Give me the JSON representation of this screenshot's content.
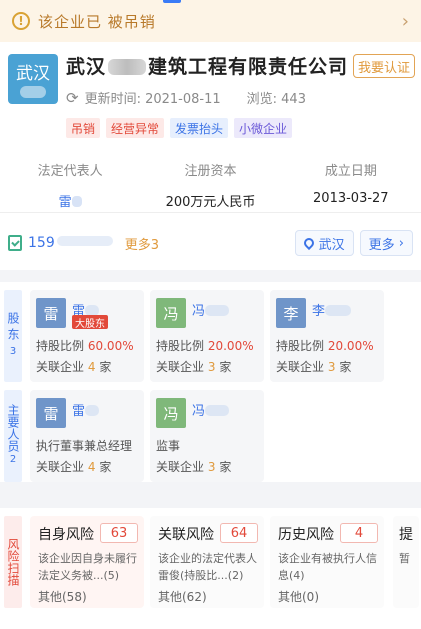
{
  "notice": {
    "text": "该企业已 被吊销",
    "arrow": "›"
  },
  "company": {
    "logo_text": "武汉",
    "name_prefix": "武汉",
    "name_suffix": "建筑工程有限责任公司",
    "claim_label": "我要认证",
    "updated_label": "更新时间: 2021-08-11",
    "views_label": "浏览: 443",
    "tags": [
      "吊销",
      "经营异常",
      "发票抬头",
      "小微企业"
    ]
  },
  "facts": [
    {
      "label": "法定代表人",
      "value": "雷"
    },
    {
      "label": "注册资本",
      "value": "200万元人民币"
    },
    {
      "label": "成立日期",
      "value": "2013-03-27"
    }
  ],
  "contact": {
    "phone_prefix": "159",
    "more_phones": "更多3",
    "location": "武汉",
    "more": "更多"
  },
  "shareholders": {
    "side_label": "股东",
    "count": "3",
    "cards": [
      {
        "avatar": "雷",
        "name": "雷",
        "tag": "大股东",
        "ratio_label": "持股比例",
        "ratio": "60.00%",
        "rel_label": "关联企业",
        "rel_count": "4",
        "rel_unit": "家"
      },
      {
        "avatar": "冯",
        "name": "冯",
        "tag": "",
        "ratio_label": "持股比例",
        "ratio": "20.00%",
        "rel_label": "关联企业",
        "rel_count": "3",
        "rel_unit": "家"
      },
      {
        "avatar": "李",
        "name": "李",
        "tag": "",
        "ratio_label": "持股比例",
        "ratio": "20.00%",
        "rel_label": "关联企业",
        "rel_count": "3",
        "rel_unit": "家"
      }
    ]
  },
  "staff": {
    "side_label": "主要人员",
    "count": "2",
    "cards": [
      {
        "avatar": "雷",
        "name": "雷",
        "role": "执行董事兼总经理",
        "rel_label": "关联企业",
        "rel_count": "4",
        "rel_unit": "家"
      },
      {
        "avatar": "冯",
        "name": "冯",
        "role": "监事",
        "rel_label": "关联企业",
        "rel_count": "3",
        "rel_unit": "家"
      }
    ]
  },
  "risk": {
    "side_label": "风险扫描",
    "cards": [
      {
        "title": "自身风险",
        "count": "63",
        "desc": "该企业因自身未履行法定义务被...(5)",
        "other": "其他(58)"
      },
      {
        "title": "关联风险",
        "count": "64",
        "desc": "该企业的法定代表人雷俊(持股比...(2)",
        "other": "其他(62)"
      },
      {
        "title": "历史风险",
        "count": "4",
        "desc": "该企业有被执行人信息(4)",
        "other": "其他(0)"
      },
      {
        "title": "提",
        "count": "",
        "desc": "暂",
        "other": ""
      }
    ]
  },
  "colors": {
    "accent": "#3b73e6",
    "danger": "#e2493a",
    "warning": "#e09a3d",
    "logo": "#4aa2d4"
  }
}
